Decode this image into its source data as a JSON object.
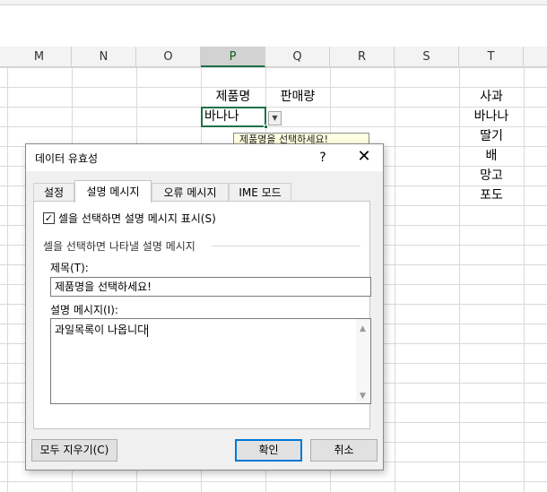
{
  "spreadsheet": {
    "columns": [
      "M",
      "N",
      "O",
      "P",
      "Q",
      "R",
      "S",
      "T"
    ],
    "selected_column": "P",
    "header_product": "제품명",
    "header_sales": "판매량",
    "active_cell_value": "바나나",
    "fruit_list": [
      "사과",
      "바나나",
      "딸기",
      "배",
      "망고",
      "포도"
    ],
    "input_tip": "제품명을 선택하세요!"
  },
  "dialog": {
    "title": "데이터 유효성",
    "help": "?",
    "close": "✕",
    "tabs": [
      "설정",
      "설명 메시지",
      "오류 메시지",
      "IME 모드"
    ],
    "active_tab": "설명 메시지",
    "checkbox_label": "셀을 선택하면 설명 메시지 표시(S)",
    "checkbox_checked": true,
    "group_label": "셀을 선택하면 나타낼 설명 메시지",
    "title_label": "제목(T):",
    "title_value": "제품명을 선택하세요!",
    "message_label": "설명 메시지(I):",
    "message_value": "과일목록이 나옵니다",
    "clear_all": "모두 지우기(C)",
    "ok": "확인",
    "cancel": "취소"
  },
  "icons": {
    "dropdown": "dropdown-arrow-icon",
    "check": "checkmark-icon"
  }
}
